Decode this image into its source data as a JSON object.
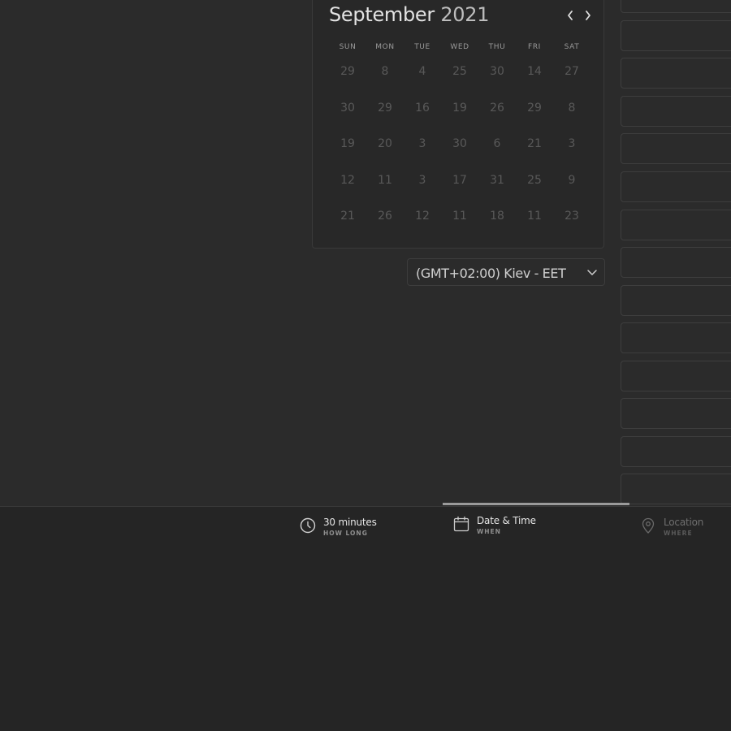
{
  "calendar": {
    "month": "September",
    "year": "2021",
    "weekdays": [
      "SUN",
      "MON",
      "TUE",
      "WED",
      "THU",
      "FRI",
      "SAT"
    ],
    "weeks": [
      [
        "29",
        "8",
        "4",
        "25",
        "30",
        "14",
        "27"
      ],
      [
        "30",
        "29",
        "16",
        "19",
        "26",
        "29",
        "8"
      ],
      [
        "19",
        "20",
        "3",
        "30",
        "6",
        "21",
        "3"
      ],
      [
        "12",
        "11",
        "3",
        "17",
        "31",
        "25",
        "9"
      ],
      [
        "21",
        "26",
        "12",
        "11",
        "18",
        "11",
        "23"
      ]
    ],
    "prev_icon": "chevron-left-icon",
    "next_icon": "chevron-right-icon"
  },
  "timezone": {
    "selected": "(GMT+02:00) Kiev - EET",
    "icon": "chevron-down-icon"
  },
  "time_slots_count": 14,
  "steps": [
    {
      "label": "30 minutes",
      "sub": "HOW LONG",
      "icon": "clock-icon",
      "active": true
    },
    {
      "label": "Date & Time",
      "sub": "WHEN",
      "icon": "calendar-icon",
      "active": true
    },
    {
      "label": "Location",
      "sub": "WHERE",
      "icon": "location-pin-icon",
      "active": false
    }
  ],
  "progress": {
    "current_step": 2,
    "total_steps": 3
  },
  "colors": {
    "background": "#2b2b2b",
    "footer_background": "#252525",
    "border": "#3a3a3a",
    "text_primary": "#e3e3e3",
    "text_muted": "#595959",
    "progress": "#9a9a9a"
  }
}
